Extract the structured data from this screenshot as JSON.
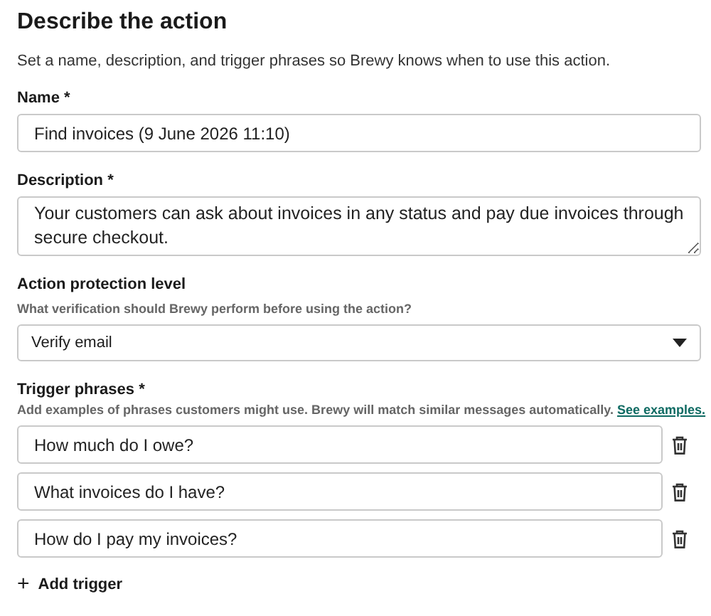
{
  "title": "Describe the action",
  "subtitle": "Set a name, description, and trigger phrases so Brewy knows when to use this action.",
  "name_field": {
    "label": "Name *",
    "value": "Find invoices (9 June 2026 11:10)"
  },
  "description_field": {
    "label": "Description *",
    "value": "Your customers can ask about invoices in any status and pay due invoices through secure checkout."
  },
  "protection": {
    "label": "Action protection level",
    "help": "What verification should Brewy perform before using the action?",
    "value": "Verify email"
  },
  "triggers": {
    "label": "Trigger phrases *",
    "help": "Add examples of phrases customers might use. Brewy will match similar messages automatically.",
    "link": "See examples.",
    "phrases": [
      "How much do I owe?",
      "What invoices do I have?",
      "How do I pay my invoices?"
    ]
  },
  "add_button": {
    "icon": "+",
    "label": "Add trigger"
  }
}
